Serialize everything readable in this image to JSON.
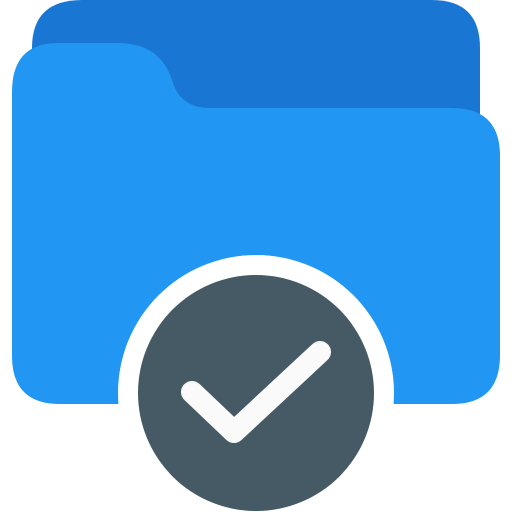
{
  "icon": {
    "name": "folder-check-icon",
    "colors": {
      "folder_back": "#1976D2",
      "folder_front": "#2196F3",
      "badge_fill": "#455A64",
      "badge_ring": "#FFFFFF",
      "check": "#FAFAFA"
    }
  }
}
